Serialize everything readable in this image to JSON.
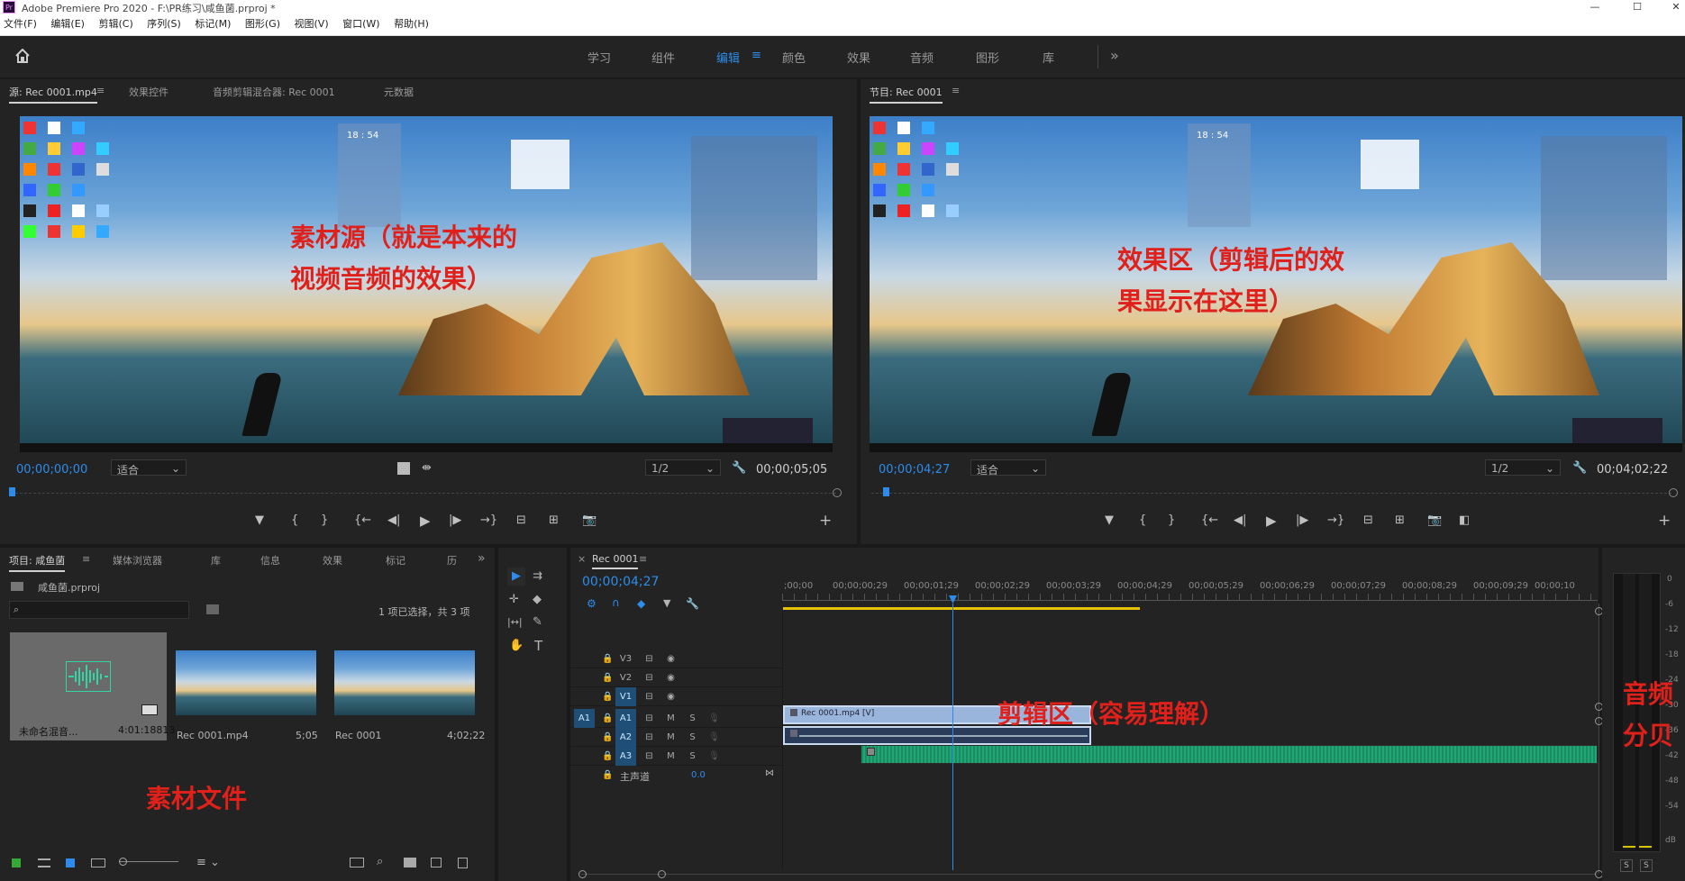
{
  "window": {
    "logo": "Pr",
    "title": "Adobe Premiere Pro 2020 - F:\\PR练习\\咸鱼菌.prproj *",
    "minimize": "—",
    "maximize": "☐",
    "close": "✕"
  },
  "menu": [
    "文件(F)",
    "编辑(E)",
    "剪辑(C)",
    "序列(S)",
    "标记(M)",
    "图形(G)",
    "视图(V)",
    "窗口(W)",
    "帮助(H)"
  ],
  "workspaces": {
    "items": [
      "学习",
      "组件",
      "编辑",
      "颜色",
      "效果",
      "音频",
      "图形",
      "库"
    ],
    "active": "编辑",
    "more": "»",
    "menu_icon": "≡",
    "home_icon": "home-icon"
  },
  "source": {
    "tabs": [
      "源: Rec 0001.mp4",
      "效果控件",
      "音频剪辑混合器: Rec 0001",
      "元数据"
    ],
    "menu": "≡",
    "timecode": "00;00;00;00",
    "fit": "适合",
    "resolution": "1/2",
    "duration": "00;00;05;05",
    "annotation_line1": "素材源（就是本来的",
    "annotation_line2": "视频音频的效果）",
    "clock": "18 : 54"
  },
  "program": {
    "tab": "节目: Rec 0001",
    "menu": "≡",
    "timecode": "00;00;04;27",
    "fit": "适合",
    "resolution": "1/2",
    "duration": "00;04;02;22",
    "annotation_line1": "效果区（剪辑后的效",
    "annotation_line2": "果显示在这里）",
    "clock": "18 : 54"
  },
  "transport": {
    "marker": "▼",
    "in": "{",
    "out": "}",
    "goin": "{←",
    "stepback": "◀|",
    "play": "▶",
    "stepfwd": "|▶",
    "goout": "→}",
    "insert": "⊟",
    "overwrite": "⊞",
    "export": "📷",
    "add": "+",
    "compare": "◧"
  },
  "project": {
    "tabs": [
      "项目: 咸鱼菌",
      "媒体浏览器",
      "库",
      "信息",
      "效果",
      "标记",
      "历"
    ],
    "menu": "≡",
    "more": "»",
    "file": "咸鱼菌.prproj",
    "search_placeholder": "",
    "selection": "1 项已选择，共 3 项",
    "items": [
      {
        "name": "未命名混音...",
        "duration": "4:01:18813"
      },
      {
        "name": "Rec 0001.mp4",
        "duration": "5;05"
      },
      {
        "name": "Rec 0001",
        "duration": "4;02;22"
      }
    ],
    "annotation": "素材文件"
  },
  "tools": {
    "select": "▶",
    "track": "⇉",
    "ripple": "✛",
    "razor": "◆",
    "slip": "|↔|",
    "pen": "✎",
    "hand": "✋",
    "type": "T"
  },
  "timeline": {
    "tab": "Rec 0001",
    "close": "×",
    "menu": "≡",
    "timecode": "00;00;04;27",
    "ruler": [
      ";00;00",
      "00;00;00;29",
      "00;00;01;29",
      "00;00;02;29",
      "00;00;03;29",
      "00;00;04;29",
      "00;00;05;29",
      "00;00;06;29",
      "00;00;07;29",
      "00;00;08;29",
      "00;00;09;29",
      "00;00;10"
    ],
    "video_tracks": [
      "V3",
      "V2",
      "V1"
    ],
    "audio_tracks": [
      "A1",
      "A2",
      "A3"
    ],
    "source_patch": "A1",
    "master": "主声道",
    "master_value": "0.0",
    "clip_video": "Rec 0001.mp4 [V]",
    "annotation": "剪辑区（容易理解）",
    "mute": "M",
    "solo": "S"
  },
  "audio_meter": {
    "ticks": [
      "0",
      "-6",
      "-12",
      "-18",
      "-24",
      "-30",
      "-36",
      "-42",
      "-48",
      "-54",
      "dB"
    ],
    "solo_left": "S",
    "solo_right": "S",
    "annotation_line1": "音频",
    "annotation_line2": "分贝"
  }
}
